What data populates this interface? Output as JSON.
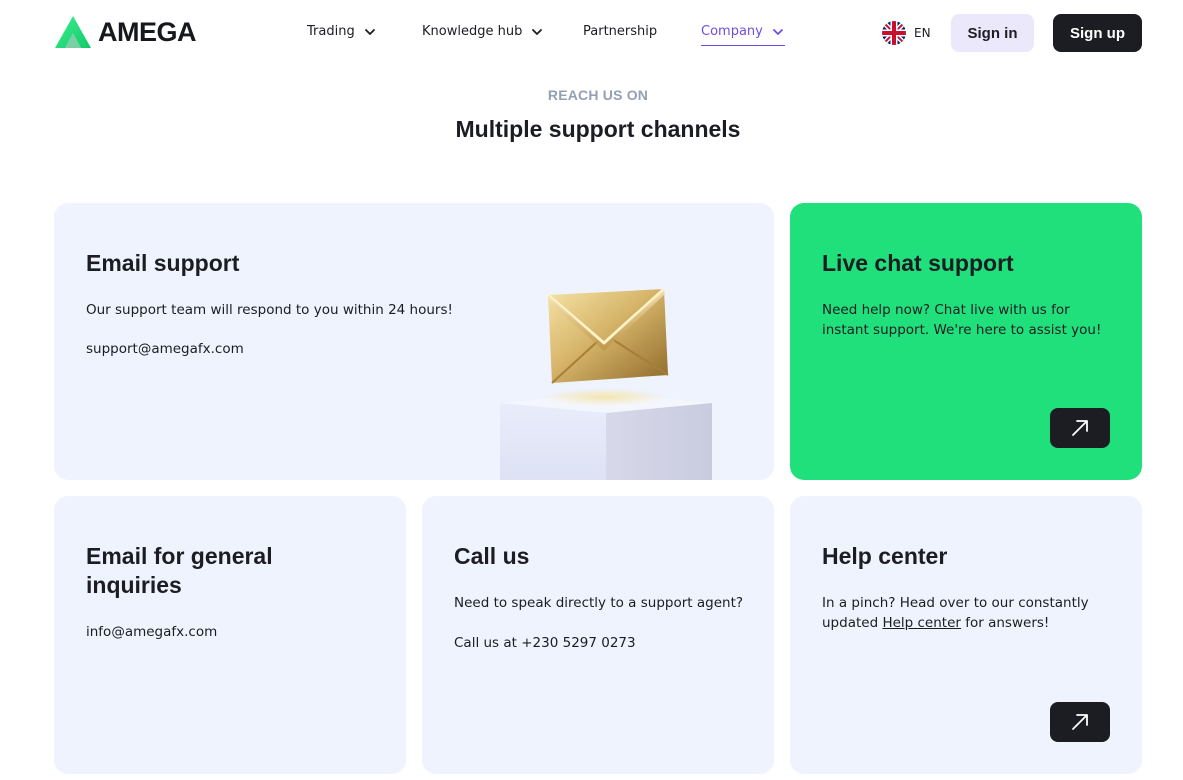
{
  "brand": {
    "name": "AMEGA",
    "accent": "#20e07c"
  },
  "nav": {
    "items": [
      {
        "label": "Trading",
        "has_dropdown": true
      },
      {
        "label": "Knowledge hub",
        "has_dropdown": true
      },
      {
        "label": "Partnership",
        "has_dropdown": false
      },
      {
        "label": "Company",
        "has_dropdown": true,
        "active": true
      }
    ]
  },
  "language": {
    "code": "EN",
    "icon": "uk-flag-icon"
  },
  "auth": {
    "signin_label": "Sign in",
    "signup_label": "Sign up"
  },
  "section": {
    "eyebrow": "REACH US ON",
    "title": "Multiple support channels"
  },
  "cards": {
    "email_support": {
      "title": "Email support",
      "text": "Our support team will respond to you within 24 hours!",
      "email": "support@amegafx.com",
      "icon": "gold-envelope-icon"
    },
    "live_chat": {
      "title": "Live chat support",
      "text": "Need help now? Chat live with us for instant support. We're here to assist you!",
      "icon": "arrow-up-right-icon"
    },
    "general": {
      "title": "Email for general inquiries",
      "email": "info@amegafx.com"
    },
    "call": {
      "title": "Call us",
      "text": "Need to speak directly to a support agent?",
      "phone": "Call us at +230 5297 0273"
    },
    "help": {
      "title": "Help center",
      "text_before": "In a pinch? Head over to our constantly updated",
      "link": "Help center",
      "text_after": "for answers!",
      "icon": "arrow-up-right-icon"
    }
  },
  "colors": {
    "card_bg": "#eff3fe",
    "dark": "#1b1d23",
    "active_nav": "#6f4ee0",
    "signin_bg": "#ece8fb",
    "eyebrow": "#93a0b3"
  }
}
